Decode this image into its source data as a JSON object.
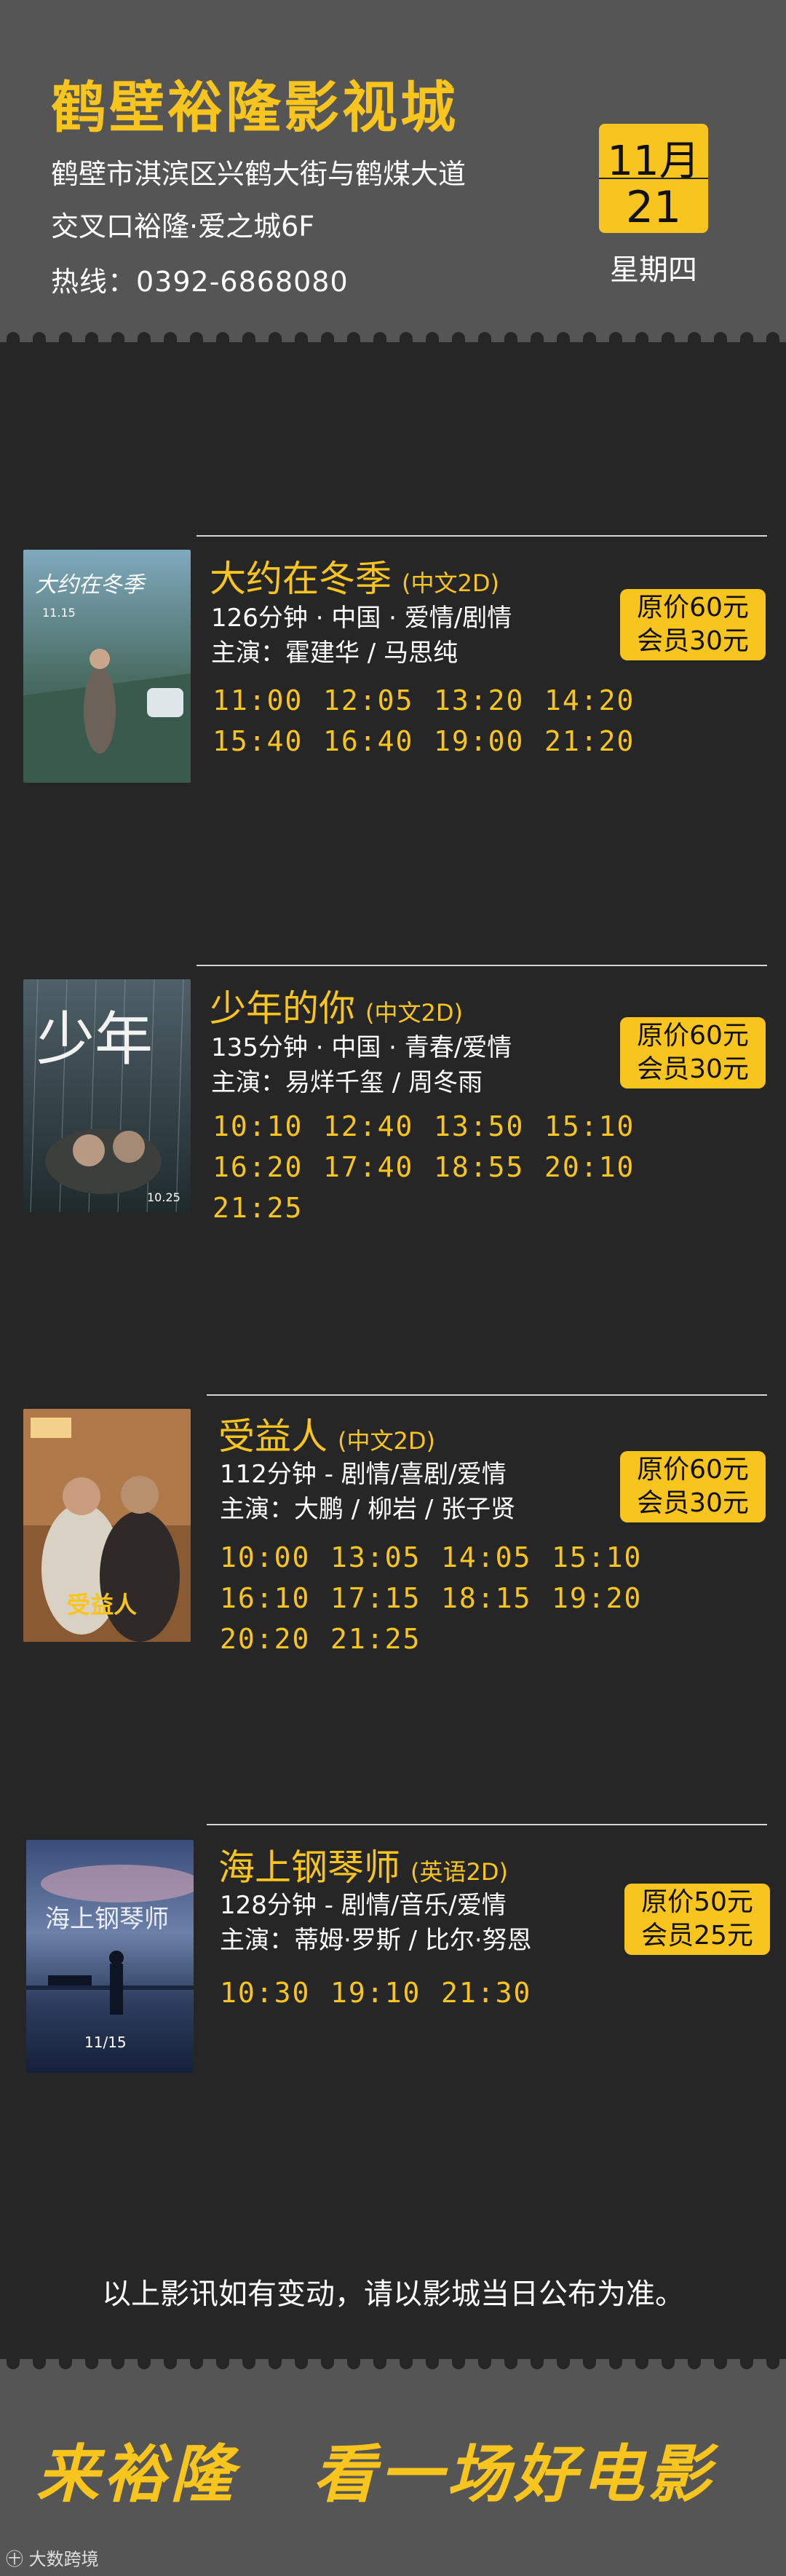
{
  "header": {
    "cinema_name": "鹤壁裕隆影视城",
    "address_line1": "鹤壁市淇滨区兴鹤大街与鹤煤大道",
    "address_line2": "交叉口裕隆·爱之城6F",
    "hotline": "热线：0392-6868080",
    "date_month": "11月",
    "date_day": "21",
    "weekday": "星期四"
  },
  "movies": [
    {
      "title": "大约在冬季",
      "format": "(中文2D)",
      "info": "126分钟 · 中国 · 爱情/剧情",
      "cast": "主演：霍建华 / 马思纯",
      "price_regular": "原价60元",
      "price_member": "会员30元",
      "poster_icon": "poster-image",
      "poster_text": "11.15",
      "showtimes": [
        "11:00",
        "12:05",
        "13:20",
        "14:20",
        "15:40",
        "16:40",
        "19:00",
        "21:20"
      ]
    },
    {
      "title": "少年的你",
      "format": "(中文2D)",
      "info": "135分钟 · 中国 · 青春/爱情",
      "cast": "主演：易烊千玺 / 周冬雨",
      "price_regular": "原价60元",
      "price_member": "会员30元",
      "poster_icon": "poster-image",
      "poster_text": "10.25",
      "showtimes": [
        "10:10",
        "12:40",
        "13:50",
        "15:10",
        "16:20",
        "17:40",
        "18:55",
        "20:10",
        "21:25"
      ]
    },
    {
      "title": "受益人",
      "format": "(中文2D)",
      "info": "112分钟 - 剧情/喜剧/爱情",
      "cast": "主演：大鹏 / 柳岩 / 张子贤",
      "price_regular": "原价60元",
      "price_member": "会员30元",
      "poster_icon": "poster-image",
      "poster_text": "受益人",
      "showtimes": [
        "10:00",
        "13:05",
        "14:05",
        "15:10",
        "16:10",
        "17:15",
        "18:15",
        "19:20",
        "20:20",
        "21:25"
      ]
    },
    {
      "title": "海上钢琴师",
      "format": "(英语2D)",
      "info": "128分钟 - 剧情/音乐/爱情",
      "cast": "主演：蒂姆·罗斯 / 比尔·努恩",
      "price_regular": "原价50元",
      "price_member": "会员25元",
      "poster_icon": "poster-image",
      "poster_text": "11/15",
      "showtimes": [
        "10:30",
        "19:10",
        "21:30"
      ]
    }
  ],
  "notice": "以上影讯如有变动，请以影城当日公布为准。",
  "footer": {
    "slogan_part1": "来裕隆",
    "slogan_part2": "看一场好电影",
    "watermark": "大数跨境"
  },
  "colors": {
    "accent": "#f7c51d",
    "background": "#262626",
    "band": "#555555",
    "text": "#ffffff"
  }
}
